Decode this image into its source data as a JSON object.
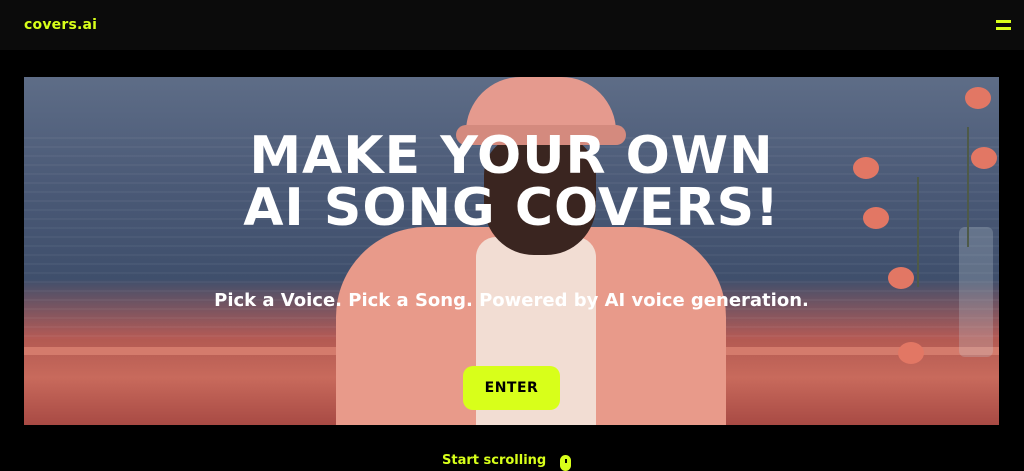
{
  "header": {
    "logo_text": "covers.ai",
    "menu_icon": "hamburger-menu-icon"
  },
  "hero": {
    "title_line1": "MAKE YOUR OWN",
    "title_line2": "AI SONG COVERS!",
    "subtitle": "Pick a Voice. Pick a Song. Powered by AI voice generation.",
    "enter_label": "ENTER"
  },
  "scroll": {
    "label": "Start scrolling",
    "icon": "mouse-icon"
  },
  "colors": {
    "accent": "#d8ff1a",
    "background": "#000000",
    "header_bg": "#0b0b0b"
  }
}
